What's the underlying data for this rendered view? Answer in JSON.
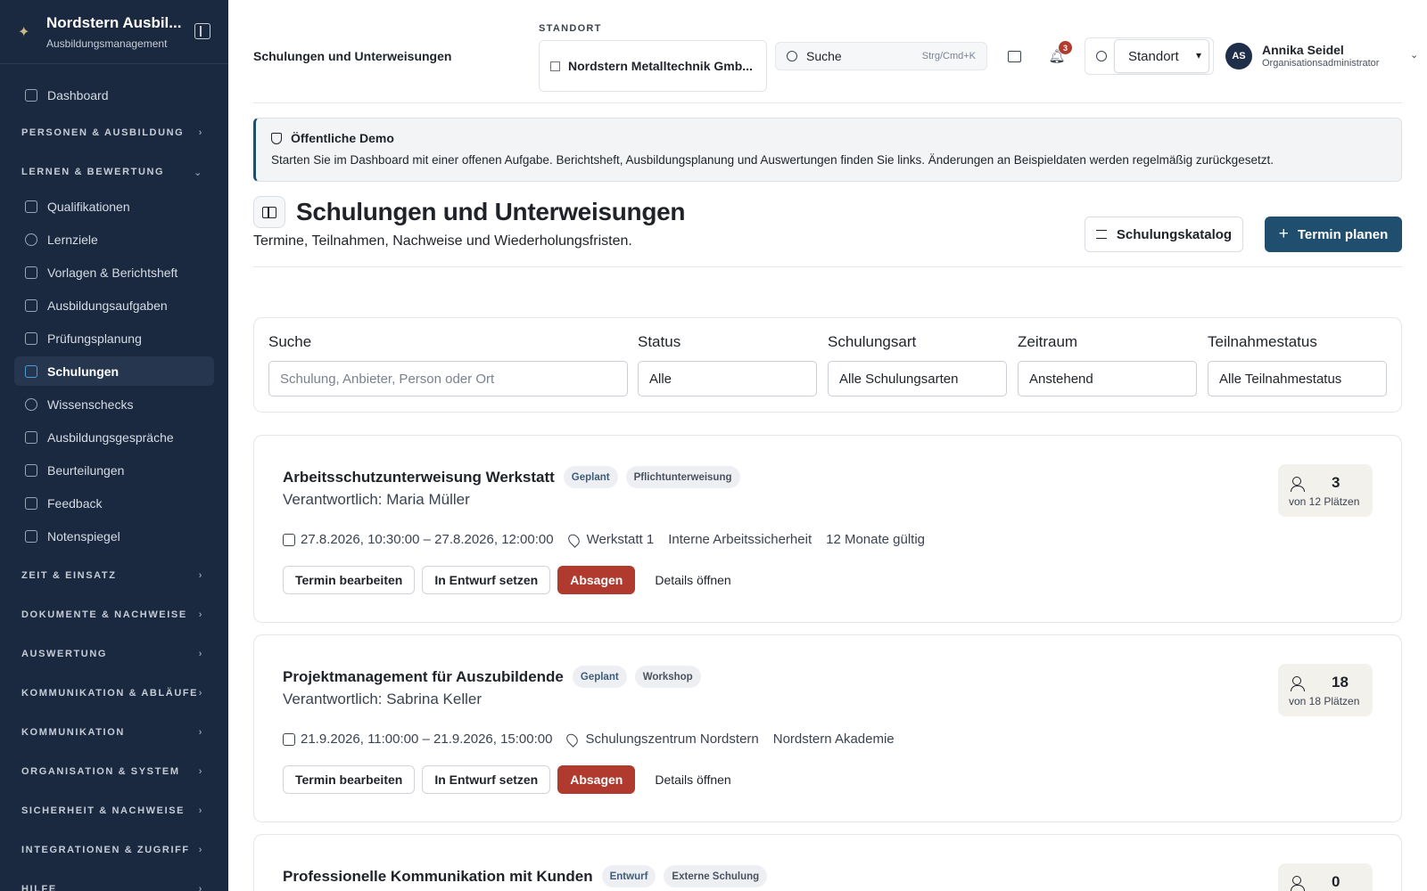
{
  "sidebar": {
    "brand_title": "Nordstern Ausbil...",
    "brand_subtitle": "Ausbildungsmanagement",
    "dashboard": "Dashboard",
    "sections": {
      "personen": "PERSONEN & AUSBILDUNG",
      "lernen": "LERNEN & BEWERTUNG",
      "zeit": "ZEIT & EINSATZ",
      "dokumente": "DOKUMENTE & NACHWEISE",
      "auswertung": "AUSWERTUNG",
      "kommunikation_ablaeufe": "KOMMUNIKATION & ABLÄUFE",
      "kommunikation": "KOMMUNIKATION",
      "organisation": "ORGANISATION & SYSTEM",
      "sicherheit": "SICHERHEIT & NACHWEISE",
      "integrationen": "INTEGRATIONEN & ZUGRIFF",
      "hilfe": "HILFE"
    },
    "lernen_items": [
      "Qualifikationen",
      "Lernziele",
      "Vorlagen & Berichtsheft",
      "Ausbildungsaufgaben",
      "Prüfungsplanung",
      "Schulungen",
      "Wissenschecks",
      "Ausbildungsgespräche",
      "Beurteilungen",
      "Feedback",
      "Notenspiegel"
    ],
    "active_item": "Schulungen"
  },
  "topbar": {
    "page_crumb": "Schulungen und Unterweisungen",
    "standort_label": "STANDORT",
    "standort_value": "Nordstern Metalltechnik Gmb...",
    "search_label": "Suche",
    "search_shortcut": "Strg/Cmd+K",
    "notification_count": "3",
    "theme_select_value": "Standort",
    "user_initials": "AS",
    "user_name": "Annika Seidel",
    "user_role": "Organisationsadministrator"
  },
  "notice": {
    "title": "Öffentliche Demo",
    "text": "Starten Sie im Dashboard mit einer offenen Aufgabe. Berichtsheft, Ausbildungsplanung und Auswertungen finden Sie links. Änderungen an Beispieldaten werden regelmäßig zurückgesetzt."
  },
  "page": {
    "title": "Schulungen und Unterweisungen",
    "subtitle": "Termine, Teilnahmen, Nachweise und Wiederholungsfristen.",
    "catalog_button": "Schulungskatalog",
    "plan_button": "Termin planen"
  },
  "filters": {
    "search_label": "Suche",
    "search_placeholder": "Schulung, Anbieter, Person oder Ort",
    "status_label": "Status",
    "status_value": "Alle",
    "type_label": "Schulungsart",
    "type_value": "Alle Schulungsarten",
    "period_label": "Zeitraum",
    "period_value": "Anstehend",
    "participation_label": "Teilnahmestatus",
    "participation_value": "Alle Teilnahmestatus"
  },
  "actions": {
    "edit": "Termin bearbeiten",
    "draft": "In Entwurf setzen",
    "cancel": "Absagen",
    "details": "Details öffnen"
  },
  "trainings": [
    {
      "title": "Arbeitsschutzunterweisung Werkstatt",
      "status": "Geplant",
      "type": "Pflichtunterweisung",
      "responsible": "Verantwortlich: Maria Müller",
      "date": "27.8.2026, 10:30:00 – 27.8.2026, 12:00:00",
      "location": "Werkstatt 1",
      "provider": "Interne Arbeitssicherheit",
      "validity": "12 Monate gültig",
      "participants": "3",
      "capacity": "von 12 Plätzen"
    },
    {
      "title": "Projektmanagement für Auszubildende",
      "status": "Geplant",
      "type": "Workshop",
      "responsible": "Verantwortlich: Sabrina Keller",
      "date": "21.9.2026, 11:00:00 – 21.9.2026, 15:00:00",
      "location": "Schulungszentrum Nordstern",
      "provider": "Nordstern Akademie",
      "participants": "18",
      "capacity": "von 18 Plätzen"
    },
    {
      "title": "Professionelle Kommunikation mit Kunden",
      "status": "Entwurf",
      "type": "Externe Schulung",
      "participants": "0"
    }
  ],
  "colors": {
    "sidebar_bg": "#1b2940",
    "primary": "#1f4e6e",
    "danger": "#b03a2e",
    "badge": "#b33a2d"
  }
}
